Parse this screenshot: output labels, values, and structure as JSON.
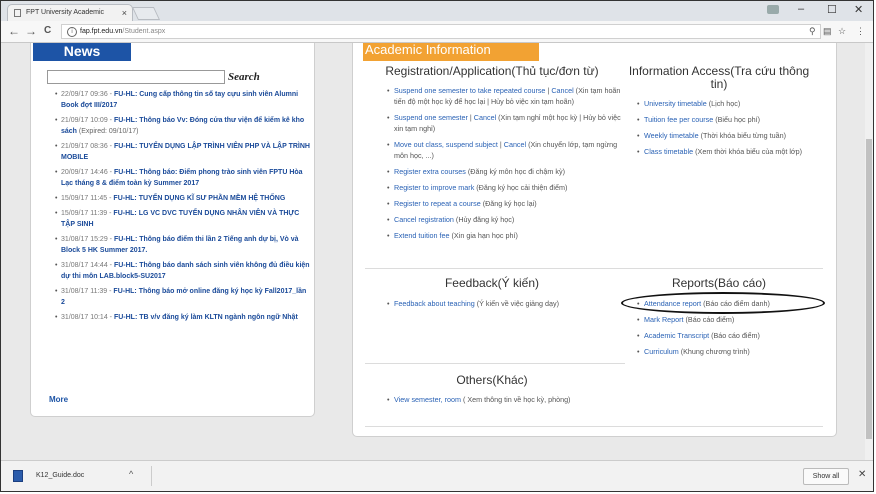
{
  "browser": {
    "tab_title": "FPT University Academic",
    "close_tab": "×",
    "url_host": "fap.fpt.edu.vn",
    "url_path": "/Student.aspx",
    "window_controls": [
      "–",
      "☐",
      "✕"
    ],
    "nav": {
      "back": "←",
      "forward": "→",
      "reload": "C"
    }
  },
  "news": {
    "header": "News",
    "search_label": "Search",
    "items": [
      {
        "date": "22/09/17 09:36 -",
        "title": "FU-HL: Cung cấp thông tin số tay cựu sinh viên Alumni Book đợt III/2017",
        "note": ""
      },
      {
        "date": "21/09/17 10:09 -",
        "title": "FU-HL: Thông báo Vv: Đóng cửa thư viện để kiểm kê kho sách",
        "note": "(Expired: 09/10/17)"
      },
      {
        "date": "21/09/17 08:36 -",
        "title": "FU-HL: TUYỂN DỤNG LẬP TRÌNH VIÊN PHP VÀ LẬP TRÌNH MOBILE",
        "note": ""
      },
      {
        "date": "20/09/17 14:46 -",
        "title": "FU-HL: Thông báo: Điểm phong trào sinh viên FPTU Hòa Lạc tháng 8 & điểm toàn kỳ Summer 2017",
        "note": ""
      },
      {
        "date": "15/09/17 11:45 -",
        "title": "FU-HL: TUYỂN DỤNG KĨ SƯ PHẦN MỀM HỆ THỐNG",
        "note": ""
      },
      {
        "date": "15/09/17 11:39 -",
        "title": "FU-HL: LG VC DVC TUYỂN DỤNG NHÂN VIÊN VÀ THỰC TẬP SINH",
        "note": ""
      },
      {
        "date": "31/08/17 15:29 -",
        "title": "FU-HL: Thông báo điểm thi lần 2 Tiếng anh dự bị, Vò và Block 5 HK Summer 2017.",
        "note": ""
      },
      {
        "date": "31/08/17 14:44 -",
        "title": "FU-HL: Thông báo danh sách sinh viên không đủ điều kiện dự thi môn LAB.block5-SU2017",
        "note": ""
      },
      {
        "date": "31/08/17 11:39 -",
        "title": "FU-HL: Thông báo mở online đăng ký học kỳ Fall2017_lần 2",
        "note": ""
      },
      {
        "date": "31/08/17 10:14 -",
        "title": "FU-HL: TB v/v đăng ký làm KLTN ngành ngôn ngữ Nhật",
        "note": ""
      }
    ],
    "more": "More"
  },
  "academic": {
    "header": "Academic Information",
    "registration": {
      "title": "Registration/Application(Thủ tục/đơn từ)",
      "items": [
        [
          {
            "t": "Suspend one semester to take repeated course",
            "link": true
          },
          {
            "t": " | ",
            "link": false
          },
          {
            "t": "Cancel",
            "link": true
          },
          {
            "t": " (Xin tạm hoãn tiến độ một học kỳ để học lại | Hủy bỏ việc xin tạm hoãn)",
            "link": false
          }
        ],
        [
          {
            "t": "Suspend one semester",
            "link": true
          },
          {
            "t": " | ",
            "link": false
          },
          {
            "t": "Cancel",
            "link": true
          },
          {
            "t": " (Xin tạm nghỉ một học kỳ | Hủy bỏ việc xin tạm nghỉ)",
            "link": false
          }
        ],
        [
          {
            "t": "Move out class, suspend subject",
            "link": true
          },
          {
            "t": " | ",
            "link": false
          },
          {
            "t": "Cancel",
            "link": true
          },
          {
            "t": " (Xin chuyển lớp, tạm ngừng môn học, ...)",
            "link": false
          }
        ],
        [
          {
            "t": "Register extra courses",
            "link": true
          },
          {
            "t": " (Đăng ký môn học đi chậm kỳ)",
            "link": false
          }
        ],
        [
          {
            "t": "Register to improve mark",
            "link": true
          },
          {
            "t": " (Đăng ký học cải thiện điểm)",
            "link": false
          }
        ],
        [
          {
            "t": "Register to repeat a course",
            "link": true
          },
          {
            "t": " (Đăng ký học lại)",
            "link": false
          }
        ],
        [
          {
            "t": "Cancel registration",
            "link": true
          },
          {
            "t": " (Hủy đăng ký học)",
            "link": false
          }
        ],
        [
          {
            "t": "Extend tuition fee",
            "link": true
          },
          {
            "t": " (Xin gia hạn học phí)",
            "link": false
          }
        ]
      ]
    },
    "info_access": {
      "title": "Information Access(Tra cứu thông tin)",
      "items": [
        [
          {
            "t": "University timetable",
            "link": true
          },
          {
            "t": " (Lịch học)",
            "link": false
          }
        ],
        [
          {
            "t": "Tuition fee per course",
            "link": true
          },
          {
            "t": " (Biểu học phí)",
            "link": false
          }
        ],
        [
          {
            "t": "Weekly timetable",
            "link": true
          },
          {
            "t": " (Thời khóa biểu từng tuần)",
            "link": false
          }
        ],
        [
          {
            "t": "Class timetable",
            "link": true
          },
          {
            "t": " (Xem thời khóa biểu của một lớp)",
            "link": false
          }
        ]
      ]
    },
    "feedback": {
      "title": "Feedback(Ý kiến)",
      "items": [
        [
          {
            "t": "Feedback about teaching",
            "link": true
          },
          {
            "t": " (Ý kiến về việc giảng dạy)",
            "link": false
          }
        ]
      ]
    },
    "reports": {
      "title": "Reports(Báo cáo)",
      "items": [
        [
          {
            "t": "Attendance report",
            "link": true
          },
          {
            "t": " (Báo cáo điểm danh)",
            "link": false
          }
        ],
        [
          {
            "t": "Mark Report",
            "link": true
          },
          {
            "t": " (Báo cáo điểm)",
            "link": false
          }
        ],
        [
          {
            "t": "Academic Transcript",
            "link": true
          },
          {
            "t": " (Báo cáo điểm)",
            "link": false
          }
        ],
        [
          {
            "t": "Curriculum",
            "link": true
          },
          {
            "t": " (Khung chương trình)",
            "link": false
          }
        ]
      ]
    },
    "others": {
      "title": "Others(Khác)",
      "items": [
        [
          {
            "t": "View semester, room",
            "link": true
          },
          {
            "t": " ( Xem thông tin về học kỳ, phòng)",
            "link": false
          }
        ]
      ]
    }
  },
  "download_bar": {
    "file_name": "K12_Guide.doc",
    "chevron": "^",
    "show_all": "Show all",
    "close": "✕"
  }
}
